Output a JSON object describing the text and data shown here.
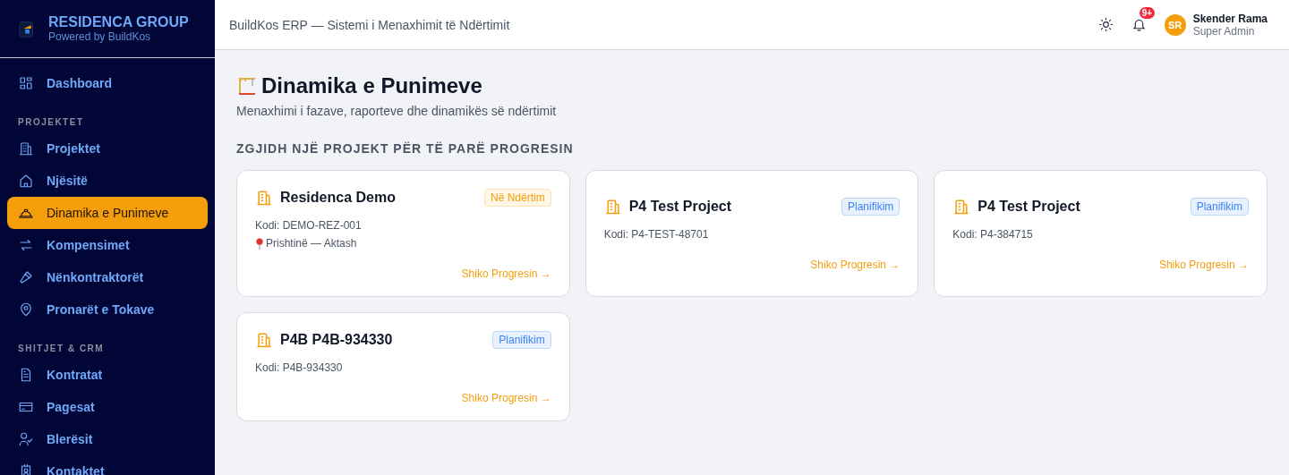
{
  "sidebar": {
    "brand": {
      "title": "RESIDENCA GROUP",
      "subtitle": "Powered by BuildKos"
    },
    "sections": [
      {
        "items": [
          {
            "label": "Dashboard",
            "selected": false
          }
        ]
      },
      {
        "heading": "PROJEKTET",
        "items": [
          {
            "label": "Projektet",
            "selected": false
          },
          {
            "label": "Njësitë",
            "selected": false
          },
          {
            "label": "Dinamika e Punimeve",
            "selected": true
          },
          {
            "label": "Kompensimet",
            "selected": false
          },
          {
            "label": "Nënkontraktorët",
            "selected": false
          },
          {
            "label": "Pronarët e Tokave",
            "selected": false
          }
        ]
      },
      {
        "heading": "SHITJET & CRM",
        "items": [
          {
            "label": "Kontratat",
            "selected": false
          },
          {
            "label": "Pagesat",
            "selected": false
          },
          {
            "label": "Blerësit",
            "selected": false
          },
          {
            "label": "Kontaktet",
            "selected": false
          }
        ]
      }
    ]
  },
  "header": {
    "title": "BuildKos ERP — Sistemi i Menaxhimit të Ndërtimit",
    "notification_count": "9+",
    "user": {
      "initials": "SR",
      "name": "Skender Rama",
      "role": "Super Admin"
    }
  },
  "page": {
    "title": "Dinamika e Punimeve",
    "subtitle": "Menaxhimi i fazave, raporteve dhe dinamikës së ndërtimit",
    "section_heading": "ZGJIDH NJË PROJEKT PËR TË PARË PROGRESIN",
    "projects": [
      {
        "name": "Residenca Demo",
        "status": "Në Ndërtim",
        "kind": "construction",
        "code": "Kodi: DEMO-REZ-001",
        "location": "Prishtinë — Aktash",
        "link": "Shiko Progresin →"
      },
      {
        "name": "P4 Test Project",
        "status": "Planifikim",
        "kind": "planning",
        "code": "Kodi: P4-TEST-48701",
        "link": "Shiko Progresin →"
      },
      {
        "name": "P4 Test Project",
        "status": "Planifikim",
        "kind": "planning",
        "code": "Kodi: P4-384715",
        "link": "Shiko Progresin →"
      },
      {
        "name": "P4B P4B-934330",
        "status": "Planifikim",
        "kind": "planning",
        "code": "Kodi: P4B-934330",
        "link": "Shiko Progresin →"
      }
    ]
  }
}
